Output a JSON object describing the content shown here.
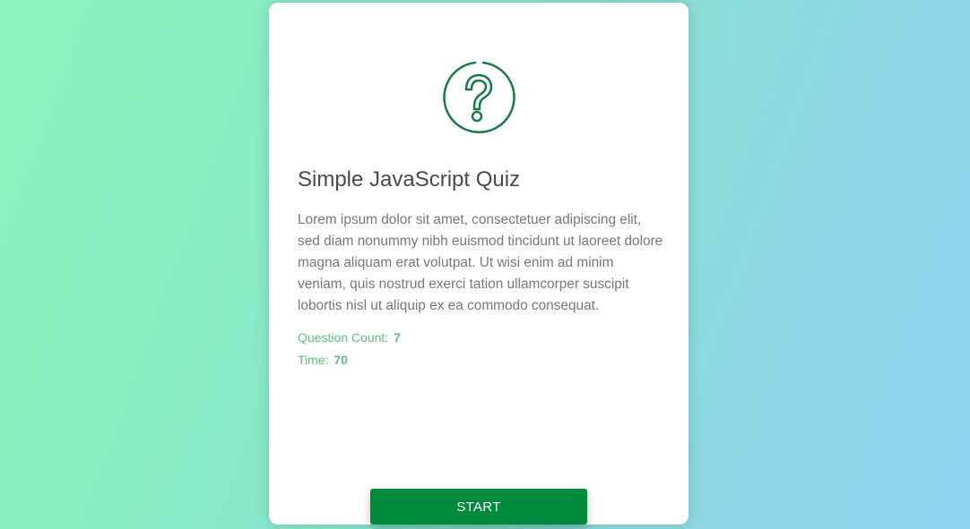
{
  "quiz": {
    "icon": "question-mark-circle-icon",
    "title": "Simple JavaScript Quiz",
    "description": "Lorem ipsum dolor sit amet, consectetuer adipiscing elit, sed diam nonummy nibh euismod tincidunt ut laoreet dolore magna aliquam erat volutpat. Ut wisi enim ad minim veniam, quis nostrud exerci tation ullamcorper suscipit lobortis nisl ut aliquip ex ea commodo consequat.",
    "question_count_label": "Question Count:",
    "question_count": "7",
    "time_label": "Time:",
    "time": "70",
    "start_label": "START"
  },
  "colors": {
    "accent": "#008a3e",
    "icon": "#1a7a45",
    "meta_text": "#5cbf83"
  }
}
